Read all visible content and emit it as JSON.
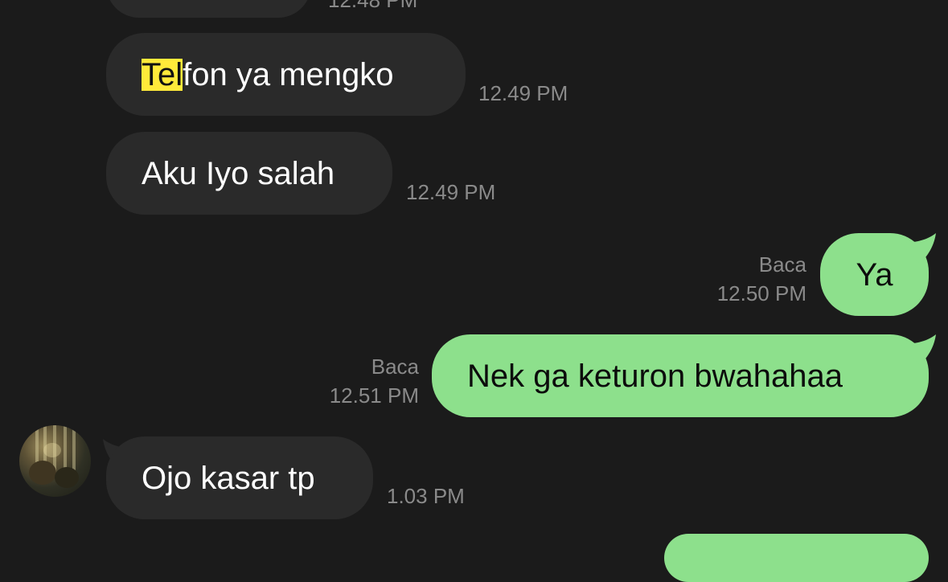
{
  "colors": {
    "background": "#1b1b1b",
    "incoming_bubble": "#2a2a2a",
    "outgoing_bubble": "#8de08c",
    "timestamp": "#8a8a8a",
    "highlight": "#ffea3a"
  },
  "top_partial_time": "12.48 PM",
  "messages": [
    {
      "direction": "incoming",
      "highlight": "Tel",
      "rest": "fon ya mengko",
      "time": "12.49 PM"
    },
    {
      "direction": "incoming",
      "text": "Aku Iyo salah",
      "time": "12.49 PM"
    },
    {
      "direction": "outgoing",
      "read": "Baca",
      "text": "Ya",
      "time": "12.50 PM"
    },
    {
      "direction": "outgoing",
      "read": "Baca",
      "text": "Nek ga keturon bwahahaa",
      "time": "12.51 PM"
    },
    {
      "direction": "incoming",
      "text": "Ojo kasar tp",
      "time": "1.03 PM",
      "avatar": "contact-avatar"
    }
  ]
}
